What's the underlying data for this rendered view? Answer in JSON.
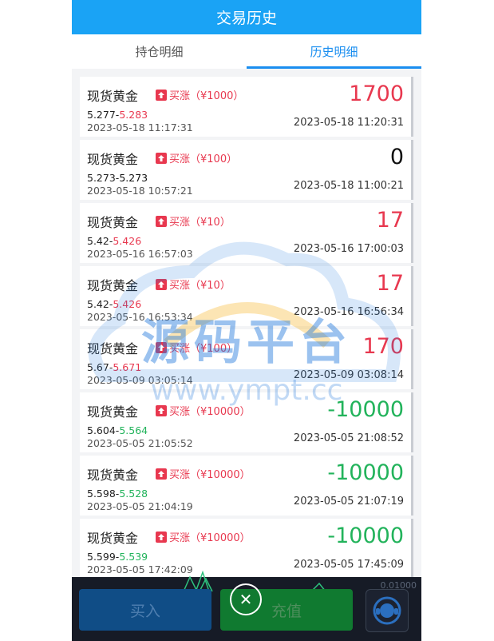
{
  "header": {
    "title": "交易历史"
  },
  "tabs": [
    {
      "label": "持仓明细",
      "active": false
    },
    {
      "label": "历史明细",
      "active": true
    }
  ],
  "colors": {
    "up": "#e8384f",
    "down": "#22b35b",
    "neutral": "#111111",
    "header": "#1aa3f5"
  },
  "records": [
    {
      "name": "现货黄金",
      "direction": "买涨（¥1000）",
      "open_price": "5.277",
      "close_price": "5.283",
      "close_color": "red",
      "open_time": "2023-05-18 11:17:31",
      "profit": "1700",
      "profit_color": "red",
      "close_time": "2023-05-18 11:20:31"
    },
    {
      "name": "现货黄金",
      "direction": "买涨（¥100）",
      "open_price": "5.273",
      "close_price": "5.273",
      "close_color": "black",
      "open_time": "2023-05-18 10:57:21",
      "profit": "0",
      "profit_color": "black",
      "close_time": "2023-05-18 11:00:21"
    },
    {
      "name": "现货黄金",
      "direction": "买涨（¥10）",
      "open_price": "5.42",
      "close_price": "5.426",
      "close_color": "red",
      "open_time": "2023-05-16 16:57:03",
      "profit": "17",
      "profit_color": "red",
      "close_time": "2023-05-16 17:00:03"
    },
    {
      "name": "现货黄金",
      "direction": "买涨（¥10）",
      "open_price": "5.42",
      "close_price": "5.426",
      "close_color": "red",
      "open_time": "2023-05-16 16:53:34",
      "profit": "17",
      "profit_color": "red",
      "close_time": "2023-05-16 16:56:34"
    },
    {
      "name": "现货黄金",
      "direction": "买涨（¥100）",
      "open_price": "5.67",
      "close_price": "5.671",
      "close_color": "red",
      "open_time": "2023-05-09 03:05:14",
      "profit": "170",
      "profit_color": "red",
      "close_time": "2023-05-09 03:08:14"
    },
    {
      "name": "现货黄金",
      "direction": "买涨（¥10000）",
      "open_price": "5.604",
      "close_price": "5.564",
      "close_color": "green",
      "open_time": "2023-05-05 21:05:52",
      "profit": "-10000",
      "profit_color": "green",
      "close_time": "2023-05-05 21:08:52"
    },
    {
      "name": "现货黄金",
      "direction": "买涨（¥10000）",
      "open_price": "5.598",
      "close_price": "5.528",
      "close_color": "green",
      "open_time": "2023-05-05 21:04:19",
      "profit": "-10000",
      "profit_color": "green",
      "close_time": "2023-05-05 21:07:19"
    },
    {
      "name": "现货黄金",
      "direction": "买涨（¥10000）",
      "open_price": "5.599",
      "close_price": "5.539",
      "close_color": "green",
      "open_time": "2023-05-05 17:42:09",
      "profit": "-10000",
      "profit_color": "green",
      "close_time": "2023-05-05 17:45:09"
    }
  ],
  "watermark": {
    "line1": "源码平台",
    "line2": "www.ympt.cc"
  },
  "bottom": {
    "buy_label": "买入",
    "recharge_label": "充值",
    "close_icon": "close-icon",
    "service_icon": "customer-service-icon",
    "tick_value": "0.01000"
  }
}
